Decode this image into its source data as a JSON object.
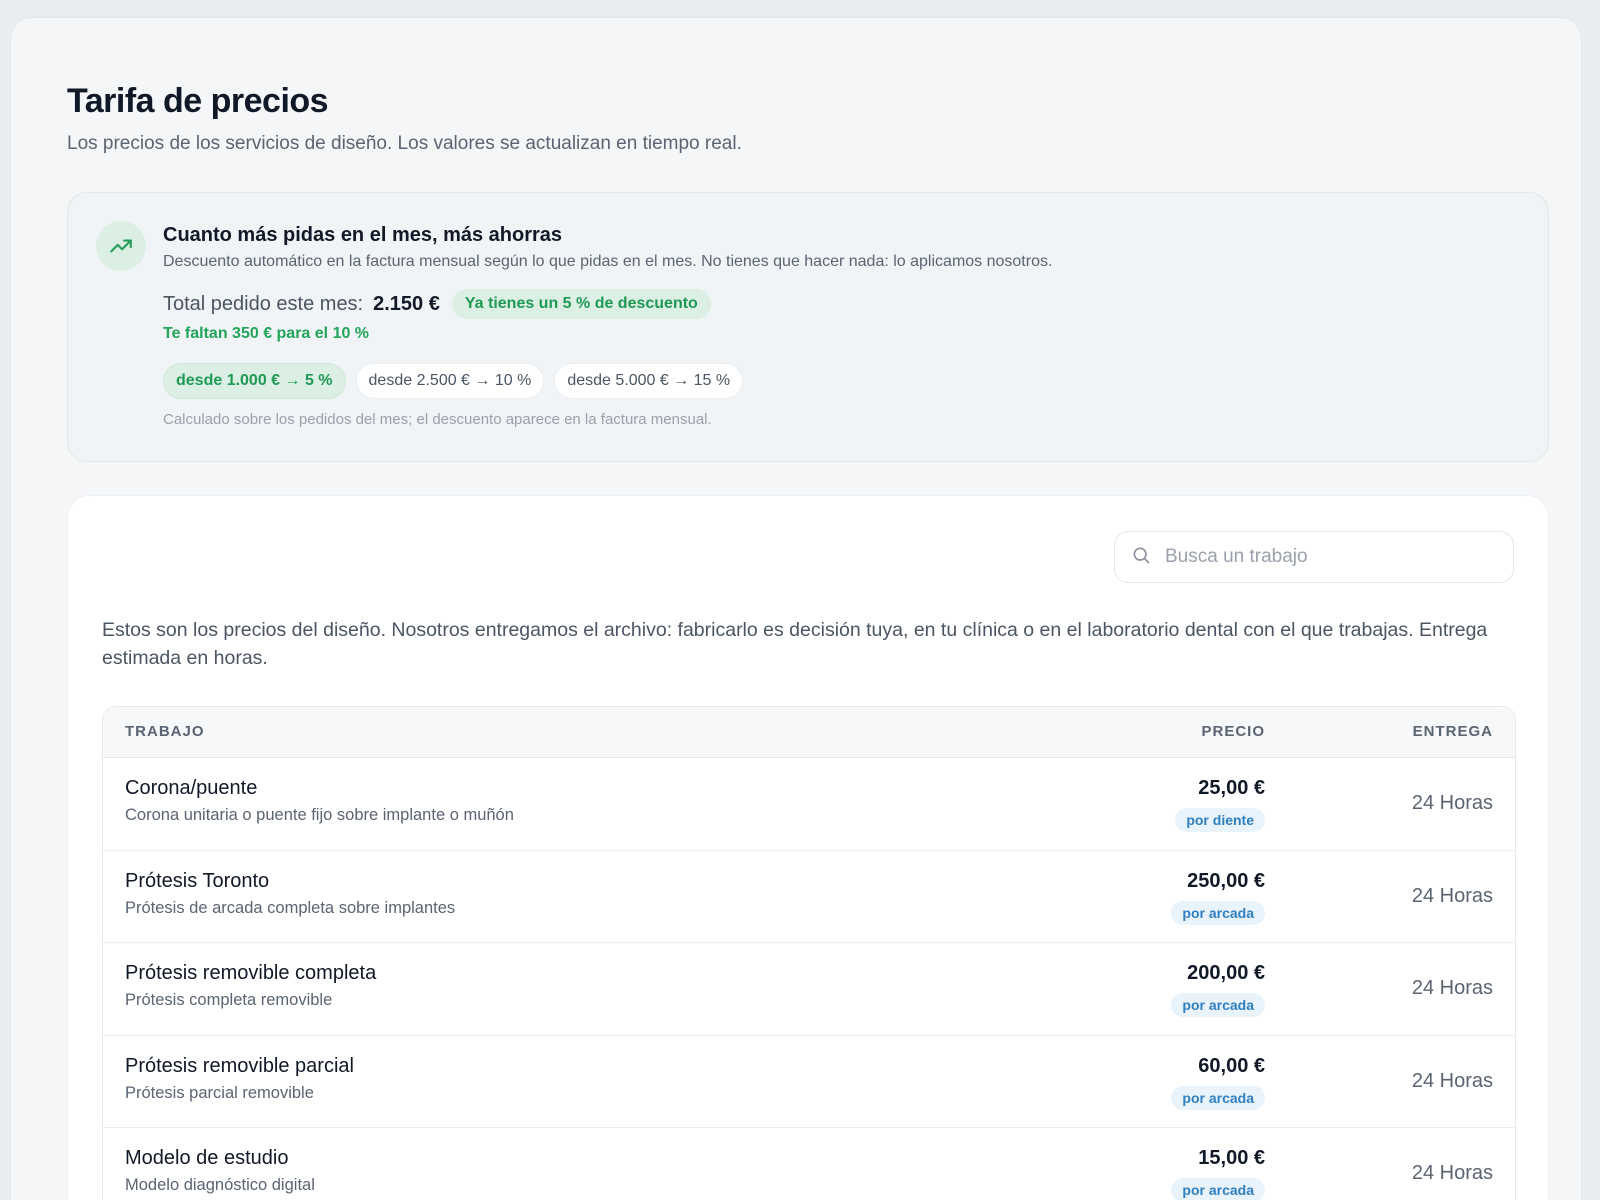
{
  "page": {
    "title": "Tarifa de precios",
    "subtitle": "Los precios de los servicios de diseño. Los valores se actualizan en tiempo real."
  },
  "discount": {
    "icon": "trending-up-icon",
    "title": "Cuanto más pidas en el mes, más ahorras",
    "description": "Descuento automático en la factura mensual según lo que pidas en el mes. No tienes que hacer nada: lo aplicamos nosotros.",
    "total_label": "Total pedido este mes:",
    "total_value": "2.150 €",
    "current_discount": "Ya tienes un 5 % de descuento",
    "missing": "Te faltan 350 € para el 10 %",
    "tiers": [
      {
        "label": "desde 1.000 € → 5 %",
        "active": true
      },
      {
        "label": "desde 2.500 € → 10 %",
        "active": false
      },
      {
        "label": "desde 5.000 € → 15 %",
        "active": false
      }
    ],
    "note": "Calculado sobre los pedidos del mes; el descuento aparece en la factura mensual."
  },
  "search": {
    "icon": "search-icon",
    "placeholder": "Busca un trabajo",
    "value": ""
  },
  "intro": "Estos son los precios del diseño. Nosotros entregamos el archivo: fabricarlo es decisión tuya, en tu clínica o en el laboratorio dental con el que trabajas. Entrega estimada en horas.",
  "table": {
    "headers": {
      "job": "TRABAJO",
      "price": "PRECIO",
      "delivery": "ENTREGA"
    },
    "rows": [
      {
        "name": "Corona/puente",
        "desc": "Corona unitaria o puente fijo sobre implante o muñón",
        "price": "25,00 €",
        "unit": "por diente",
        "delivery": "24 Horas"
      },
      {
        "name": "Prótesis Toronto",
        "desc": "Prótesis de arcada completa sobre implantes",
        "price": "250,00 €",
        "unit": "por arcada",
        "delivery": "24 Horas"
      },
      {
        "name": "Prótesis removible completa",
        "desc": "Prótesis completa removible",
        "price": "200,00 €",
        "unit": "por arcada",
        "delivery": "24 Horas"
      },
      {
        "name": "Prótesis removible parcial",
        "desc": "Prótesis parcial removible",
        "price": "60,00 €",
        "unit": "por arcada",
        "delivery": "24 Horas"
      },
      {
        "name": "Modelo de estudio",
        "desc": "Modelo diagnóstico digital",
        "price": "15,00 €",
        "unit": "por arcada",
        "delivery": "24 Horas"
      }
    ]
  },
  "colors": {
    "accent_green": "#22a45a",
    "unit_blue": "#2f7fc1"
  }
}
